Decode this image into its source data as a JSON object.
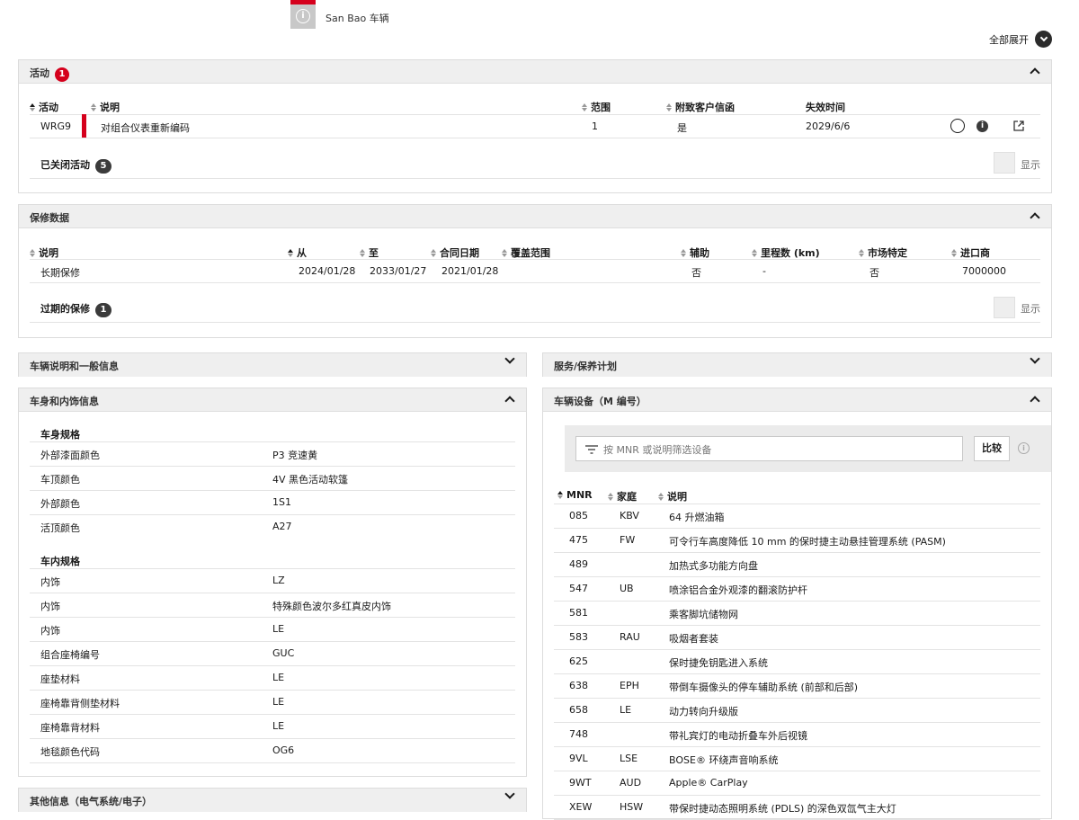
{
  "top": {
    "vehicle_label": "San Bao 车辆",
    "expand_all": "全部展开"
  },
  "activities": {
    "title": "活动",
    "count": "1",
    "columns": [
      "活动",
      "说明",
      "范围",
      "附致客户信函",
      "失效时间"
    ],
    "rows": [
      {
        "code": "WRG9",
        "desc": "对组合仪表重新编码",
        "scope": "1",
        "letter": "是",
        "expiry": "2029/6/6"
      }
    ],
    "closed_label": "已关闭活动",
    "closed_count": "5",
    "show_label": "显示"
  },
  "warranty": {
    "title": "保修数据",
    "columns": [
      "说明",
      "从",
      "至",
      "合同日期",
      "覆盖范围",
      "辅助",
      "里程数 (km)",
      "市场特定",
      "进口商"
    ],
    "rows": [
      {
        "desc": "长期保修",
        "from": "2024/01/28",
        "to": "2033/01/27",
        "contract": "2021/01/28",
        "coverage": "",
        "aux": "否",
        "mileage": "-",
        "market": "否",
        "importer": "7000000"
      }
    ],
    "expired_label": "过期的保修",
    "expired_count": "1",
    "show_label": "显示"
  },
  "vehicle_general": {
    "title": "车辆说明和一般信息"
  },
  "service_plan": {
    "title": "服务/保养计划"
  },
  "body_interior": {
    "title": "车身和内饰信息",
    "body_heading": "车身规格",
    "body_rows": [
      {
        "key": "外部漆面颜色",
        "value": "P3 竞速黄"
      },
      {
        "key": "车顶颜色",
        "value": "4V 黑色活动软篷"
      },
      {
        "key": "外部颜色",
        "value": "1S1"
      },
      {
        "key": "活顶颜色",
        "value": "A27"
      }
    ],
    "interior_heading": "车内规格",
    "interior_rows": [
      {
        "key": "内饰",
        "value": "LZ"
      },
      {
        "key": "内饰",
        "value": "特殊颜色波尔多红真皮内饰"
      },
      {
        "key": "内饰",
        "value": "LE"
      },
      {
        "key": "组合座椅编号",
        "value": "GUC"
      },
      {
        "key": "座垫材料",
        "value": "LE"
      },
      {
        "key": "座椅靠背侧垫材料",
        "value": "LE"
      },
      {
        "key": "座椅靠背材料",
        "value": "LE"
      },
      {
        "key": "地毯颜色代码",
        "value": "OG6"
      }
    ]
  },
  "other_info": {
    "title": "其他信息（电气系统/电子）"
  },
  "equipment": {
    "title": "车辆设备（M 编号）",
    "filter_placeholder": "按 MNR 或说明筛选设备",
    "compare_label": "比较",
    "columns": [
      "MNR",
      "家庭",
      "说明"
    ],
    "rows": [
      {
        "mnr": "085",
        "family": "KBV",
        "desc": "64 升燃油箱"
      },
      {
        "mnr": "475",
        "family": "FW",
        "desc": "可令行车高度降低 10 mm 的保时捷主动悬挂管理系统 (PASM)"
      },
      {
        "mnr": "489",
        "family": "",
        "desc": "加热式多功能方向盘"
      },
      {
        "mnr": "547",
        "family": "UB",
        "desc": "喷涂铝合金外观漆的翻滚防护杆"
      },
      {
        "mnr": "581",
        "family": "",
        "desc": "乘客脚坑储物网"
      },
      {
        "mnr": "583",
        "family": "RAU",
        "desc": "吸烟者套装"
      },
      {
        "mnr": "625",
        "family": "",
        "desc": "保时捷免钥匙进入系统"
      },
      {
        "mnr": "638",
        "family": "EPH",
        "desc": "带倒车摄像头的停车辅助系统 (前部和后部)"
      },
      {
        "mnr": "658",
        "family": "LE",
        "desc": "动力转向升级版"
      },
      {
        "mnr": "748",
        "family": "",
        "desc": "带礼宾灯的电动折叠车外后视镜"
      },
      {
        "mnr": "9VL",
        "family": "LSE",
        "desc": "BOSE® 环绕声音响系统"
      },
      {
        "mnr": "9WT",
        "family": "AUD",
        "desc": "Apple® CarPlay"
      },
      {
        "mnr": "XEW",
        "family": "HSW",
        "desc": "带保时捷动态照明系统 (PDLS) 的深色双氙气主大灯"
      }
    ]
  },
  "colors": {
    "accent_red": "#d5001c",
    "header_gray": "#efefef"
  }
}
